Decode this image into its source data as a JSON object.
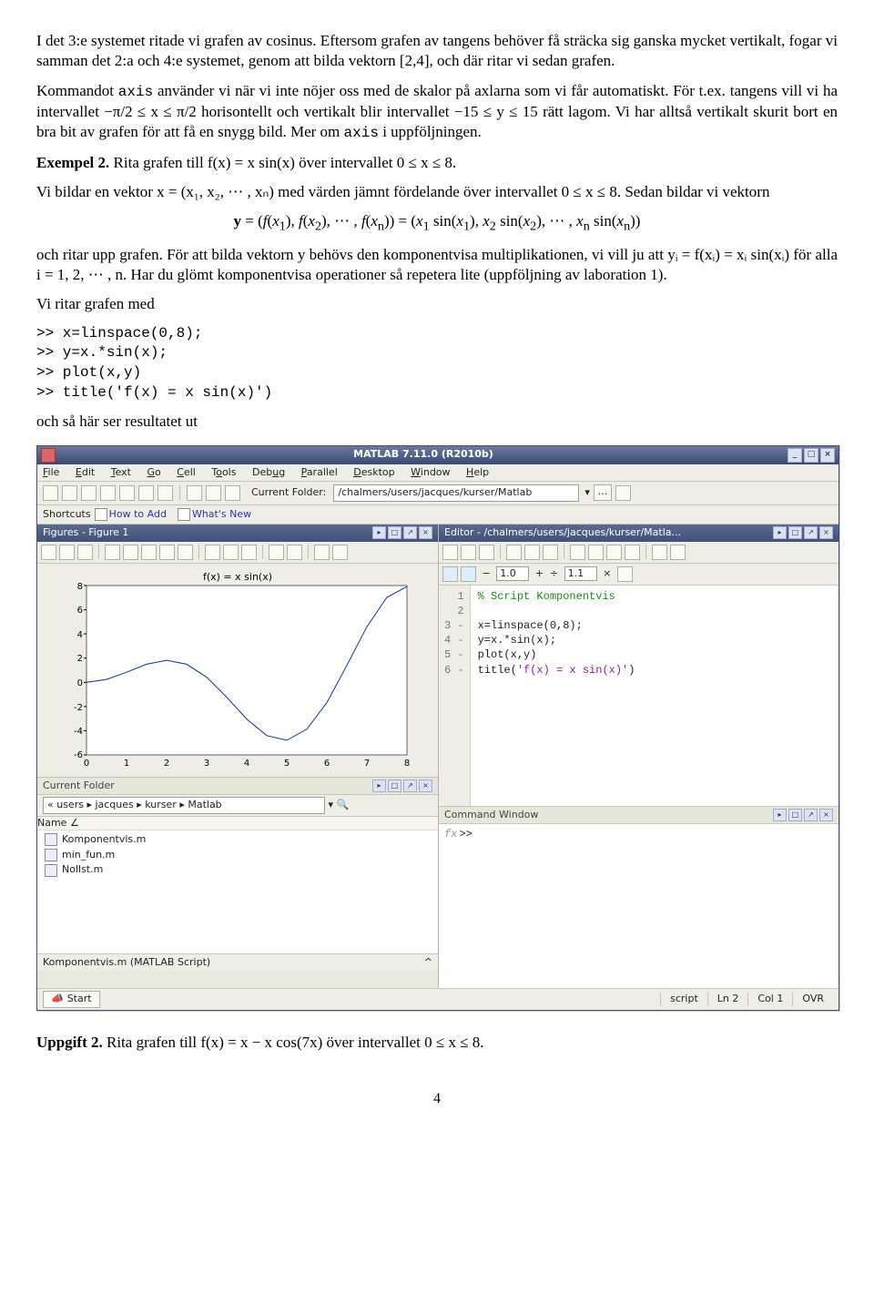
{
  "para1": "I det 3:e systemet ritade vi grafen av cosinus. Eftersom grafen av tangens behöver få sträcka sig ganska mycket vertikalt, fogar vi samman det 2:a och 4:e systemet, genom att bilda vektorn [2,4], och där ritar vi sedan grafen.",
  "para2_pre": "Kommandot ",
  "para2_axis": "axis",
  "para2_mid": " använder vi när vi inte nöjer oss med de skalor på axlarna som vi får automatiskt. För t.ex. tangens vill vi ha intervallet −π/2 ≤ x ≤ π/2 horisontellt och vertikalt blir intervallet −15 ≤ y ≤ 15 rätt lagom. Vi har alltså vertikalt skurit bort en bra bit av grafen för att få en snygg bild. Mer om ",
  "para2_axis2": "axis",
  "para2_end": " i uppföljningen.",
  "ex2_label": "Exempel 2.",
  "ex2_text": " Rita grafen till f(x) = x sin(x) över intervallet 0 ≤ x ≤ 8.",
  "para3": "Vi bildar en vektor x = (x₁, x₂, ⋯ , xₙ) med värden jämnt fördelande över intervallet 0 ≤ x ≤ 8. Sedan bildar vi vektorn",
  "eq1": "y = (f(x₁), f(x₂), ⋯ , f(xₙ)) = (x₁ sin(x₁), x₂ sin(x₂), ⋯ , xₙ sin(xₙ))",
  "para4": "och ritar upp grafen. För att bilda vektorn y behövs den komponentvisa multiplikationen, vi vill ju att yᵢ = f(xᵢ) = xᵢ sin(xᵢ) för alla i = 1, 2, ⋯ , n. Har du glömt komponentvisa operationer så repetera lite (uppföljning av laboration 1).",
  "para5": "Vi ritar grafen med",
  "code": ">> x=linspace(0,8);\n>> y=x.*sin(x);\n>> plot(x,y)\n>> title('f(x) = x sin(x)')",
  "para6": "och så här ser resultatet ut",
  "upp2_label": "Uppgift 2.",
  "upp2_text": " Rita grafen till f(x) = x − x cos(7x) över intervallet 0 ≤ x ≤ 8.",
  "page_no": "4",
  "matlab": {
    "title": "MATLAB  7.11.0 (R2010b)",
    "menus": [
      "File",
      "Edit",
      "Text",
      "Go",
      "Cell",
      "Tools",
      "Debug",
      "Parallel",
      "Desktop",
      "Window",
      "Help"
    ],
    "cf_label": "Current Folder:",
    "cf_value": "/chalmers/users/jacques/kurser/Matlab",
    "shortcuts_label": "Shortcuts",
    "shortcuts": [
      "How to Add",
      "What's New"
    ],
    "figures_title": "Figures - Figure 1",
    "editor_title": "Editor - /chalmers/users/jacques/kurser/Matla...",
    "plot_title": "f(x) = x sin(x)",
    "folder_title": "Current Folder",
    "cmd_title": "Command Window",
    "crumb": "« users ▸ jacques ▸ kurser ▸ Matlab",
    "name_header": "Name ∠",
    "files": [
      "Komponentvis.m",
      "min_fun.m",
      "Nollst.m"
    ],
    "footer_file": "Komponentvis.m (MATLAB Script)",
    "start": "Start",
    "status_script": "script",
    "status_ln": "Ln  2",
    "status_col": "Col  1",
    "status_ovr": "OVR",
    "ed_box1": "1.0",
    "ed_box2": "1.1",
    "gutter": "1\n2\n3 -\n4 -\n5 -\n6 -",
    "ed_line1": "% Script Komponentvis",
    "ed_line3": "x=linspace(0,8);",
    "ed_line4": "y=x.*sin(x);",
    "ed_line5": "plot(x,y)",
    "ed_line6a": "title(",
    "ed_line6b": "'f(x) = x sin(x)'",
    "ed_line6c": ")",
    "cmd_prompt": ">>"
  },
  "chart_data": {
    "type": "line",
    "title": "f(x) = x sin(x)",
    "xlabel": "",
    "ylabel": "",
    "xlim": [
      0,
      8
    ],
    "ylim": [
      -6,
      8
    ],
    "xticks": [
      0,
      1,
      2,
      3,
      4,
      5,
      6,
      7,
      8
    ],
    "yticks": [
      -6,
      -4,
      -2,
      0,
      2,
      4,
      6,
      8
    ],
    "x": [
      0,
      0.5,
      1,
      1.5,
      2,
      2.5,
      3,
      3.5,
      4,
      4.5,
      5,
      5.5,
      6,
      6.5,
      7,
      7.5,
      8
    ],
    "y": [
      0,
      0.24,
      0.84,
      1.5,
      1.82,
      1.5,
      0.42,
      -1.23,
      -3.03,
      -4.4,
      -4.79,
      -3.88,
      -1.68,
      1.4,
      4.6,
      7.03,
      7.91
    ]
  }
}
